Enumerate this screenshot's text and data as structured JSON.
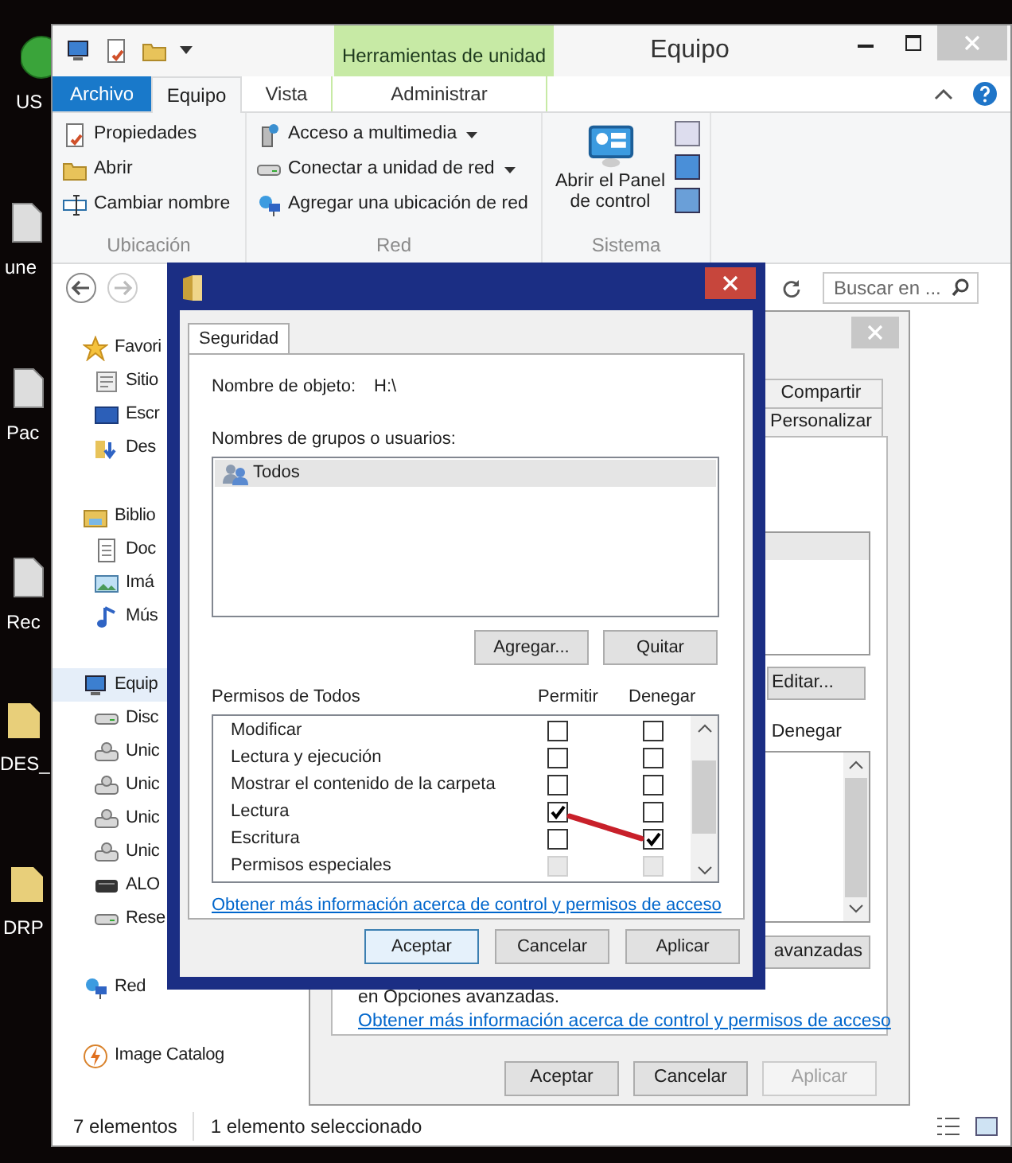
{
  "desktop": {
    "icon_labels": [
      {
        "label": "US",
        "kind": "round"
      },
      {
        "label": "une",
        "kind": "app"
      },
      {
        "label": "Pac",
        "kind": "app"
      },
      {
        "label": "Rec",
        "kind": "app"
      },
      {
        "label": "DES_",
        "kind": "folder"
      },
      {
        "label": "DRP",
        "kind": "folder"
      }
    ]
  },
  "explorer": {
    "title": "Equipo",
    "context_tab": "Herramientas de unidad",
    "tabs": [
      {
        "label": "Archivo",
        "kind": "file",
        "selected": false
      },
      {
        "label": "Equipo",
        "kind": "tab",
        "selected": true
      },
      {
        "label": "Vista",
        "kind": "tab",
        "selected": false
      },
      {
        "label": "Administrar",
        "kind": "context",
        "selected": false
      }
    ],
    "ribbon_groups": [
      {
        "name": "Ubicación",
        "items": [
          {
            "label": "Propiedades"
          },
          {
            "label": "Abrir"
          },
          {
            "label": "Cambiar nombre"
          }
        ]
      },
      {
        "name": "Red",
        "items": [
          {
            "label": "Acceso a multimedia",
            "dropdown": true
          },
          {
            "label": "Conectar a unidad de red",
            "dropdown": true
          },
          {
            "label": "Agregar una ubicación de red"
          }
        ]
      },
      {
        "name": "Sistema",
        "items": [
          {
            "label": "Abrir el Panel de control"
          }
        ]
      }
    ],
    "search": {
      "placeholder": "Buscar en ..."
    },
    "nav": [
      {
        "label": "Favori",
        "selected": false,
        "children": [
          {
            "label": "Sitio",
            "selected": false
          },
          {
            "label": "Escr",
            "selected": false
          },
          {
            "label": "Des",
            "selected": false
          }
        ]
      },
      {
        "label": "Biblio",
        "selected": false,
        "children": [
          {
            "label": "Doc",
            "selected": false
          },
          {
            "label": "Imá",
            "selected": false
          },
          {
            "label": "Mús",
            "selected": false
          }
        ]
      },
      {
        "label": "Equip",
        "selected": true,
        "children": [
          {
            "label": "Disc",
            "selected": false
          },
          {
            "label": "Unic",
            "selected": false
          },
          {
            "label": "Unic",
            "selected": false
          },
          {
            "label": "Unic",
            "selected": false
          },
          {
            "label": "Unic",
            "selected": false
          },
          {
            "label": "ALO",
            "selected": false
          },
          {
            "label": "Rese",
            "selected": false
          }
        ]
      },
      {
        "label": "Red",
        "selected": false
      },
      {
        "label": "Image Catalog",
        "selected": false
      }
    ],
    "status_bar": [
      "7 elementos",
      "1 elemento seleccionado"
    ]
  },
  "properties_dialog": {
    "tabs": [
      {
        "label": "Compartir",
        "selected": false
      },
      {
        "label": "Personalizar",
        "selected": false
      }
    ],
    "edit_button": "Editar...",
    "column_header": "Denegar",
    "advanced_button": "avanzadas",
    "note": "en Opciones avanzadas.",
    "link": "Obtener más información acerca de control y permisos de acceso",
    "buttons": [
      {
        "label": "Aceptar",
        "disabled": false
      },
      {
        "label": "Cancelar",
        "disabled": false
      },
      {
        "label": "Aplicar",
        "disabled": true
      }
    ]
  },
  "permissions_dialog": {
    "tabs": [
      {
        "label": "Seguridad",
        "selected": true
      }
    ],
    "object_label": "Nombre de objeto:",
    "object_value": "H:\\",
    "groups_label": "Nombres de grupos o usuarios:",
    "groups": [
      {
        "label": "Todos",
        "selected": true
      }
    ],
    "group_buttons": [
      "Agregar...",
      "Quitar"
    ],
    "permissions_label": "Permisos de Todos",
    "columns": [
      "Permitir",
      "Denegar"
    ],
    "permissions": [
      {
        "label": "Modificar",
        "allow": false,
        "deny": false,
        "disabled": false
      },
      {
        "label": "Lectura y ejecución",
        "allow": false,
        "deny": false,
        "disabled": false
      },
      {
        "label": "Mostrar el contenido de la carpeta",
        "allow": false,
        "deny": false,
        "disabled": false
      },
      {
        "label": "Lectura",
        "allow": true,
        "deny": false,
        "disabled": false
      },
      {
        "label": "Escritura",
        "allow": false,
        "deny": true,
        "disabled": false
      },
      {
        "label": "Permisos especiales",
        "allow": false,
        "deny": false,
        "disabled": true
      }
    ],
    "link": "Obtener más información acerca de control y permisos de acceso",
    "buttons": [
      {
        "label": "Aceptar",
        "default": true
      },
      {
        "label": "Cancelar",
        "default": false
      },
      {
        "label": "Aplicar",
        "default": false
      }
    ]
  }
}
